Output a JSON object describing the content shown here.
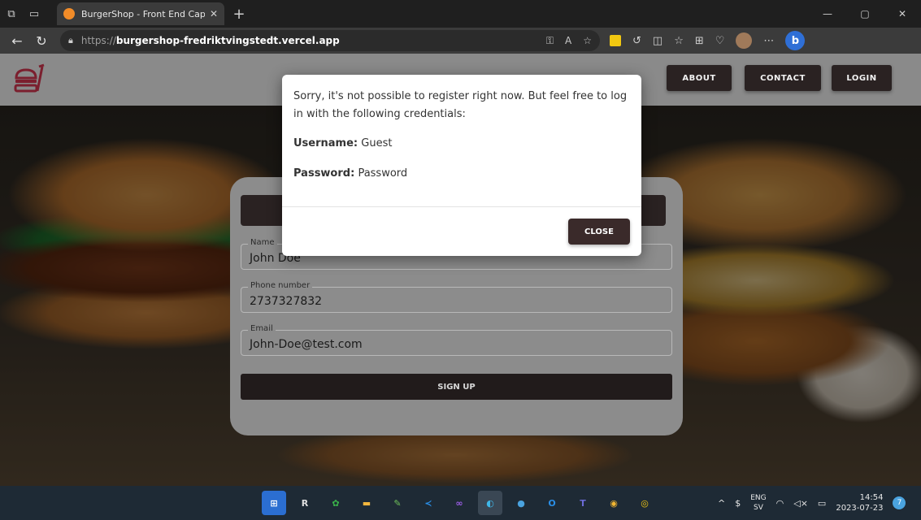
{
  "browser": {
    "tab_title": "BurgerShop - Front End Capstone",
    "new_tab_label": "+",
    "url_prefix": "https://",
    "url_host": "burgershop-fredriktvingstedt.vercel.app",
    "window_controls": [
      "—",
      "▢",
      "✕"
    ]
  },
  "header": {
    "logo_icon": "burger-logo-icon",
    "nav": {
      "about": "ABOUT",
      "contact": "CONTACT",
      "login": "LOGIN"
    }
  },
  "signup": {
    "name_label": "Name",
    "name_value": "John Doe",
    "phone_label": "Phone number",
    "phone_value": "2737327832",
    "email_label": "Email",
    "email_value": "John-Doe@test.com",
    "submit_label": "SIGN UP"
  },
  "modal": {
    "message": "Sorry, it's not possible to register right now. But feel free to log in with the following credentials:",
    "username_label": "Username:",
    "username_value": "Guest",
    "password_label": "Password:",
    "password_value": "Password",
    "close_label": "CLOSE"
  },
  "taskbar": {
    "lang_top": "ENG",
    "lang_bottom": "SV",
    "time": "14:54",
    "date": "2023-07-23",
    "notification_count": "7"
  },
  "colors": {
    "brand_dark": "#2a2222",
    "logo": "#7b1f2e",
    "modal_bg": "#ffffff",
    "taskbar": "#1e2a35"
  }
}
